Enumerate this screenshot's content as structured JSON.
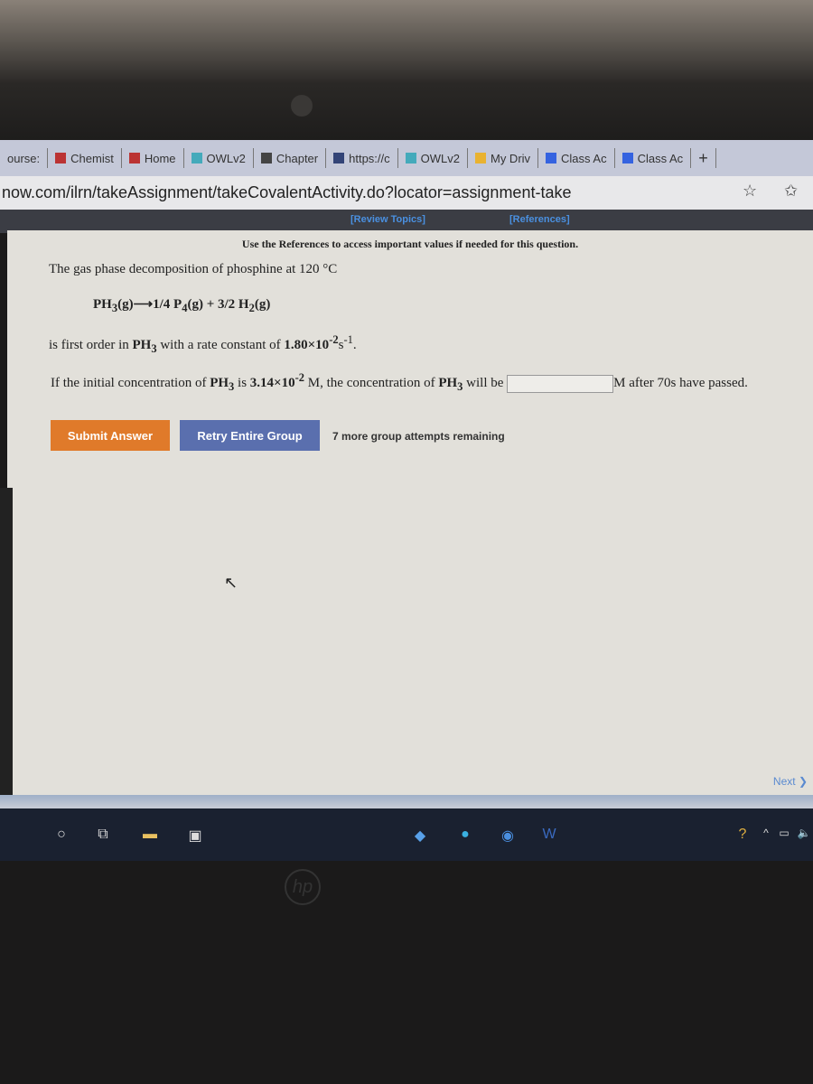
{
  "browser": {
    "tabs": [
      {
        "label": "ourse:",
        "icon": "page-icon"
      },
      {
        "label": "Chemist",
        "icon": "book-icon"
      },
      {
        "label": "Home",
        "icon": "book-icon"
      },
      {
        "label": "OWLv2",
        "icon": "owl-icon"
      },
      {
        "label": "Chapter",
        "icon": "chapter-icon"
      },
      {
        "label": "https://c",
        "icon": "image-icon"
      },
      {
        "label": "OWLv2",
        "icon": "owl-icon"
      },
      {
        "label": "My Driv",
        "icon": "drive-icon"
      },
      {
        "label": "Class Ac",
        "icon": "doc-icon"
      },
      {
        "label": "Class Ac",
        "icon": "doc-icon"
      }
    ],
    "new_tab": "+",
    "url": "now.com/ilrn/takeAssignment/takeCovalentActivity.do?locator=assignment-take"
  },
  "toolbar": {
    "review_topics": "[Review Topics]",
    "references": "[References]"
  },
  "question": {
    "ref_note": "Use the References to access important values if needed for this question.",
    "intro": "The gas phase decomposition of phosphine at 120 °C",
    "eq_lhs": "PH",
    "eq_lhs_sub": "3",
    "eq_lhs_end": "(g)",
    "eq_arrow": "⟶",
    "eq_p": "1/4 P",
    "eq_p_sub": "4",
    "eq_p_end": "(g) + 3/2 H",
    "eq_h_sub": "2",
    "eq_h_end": "(g)",
    "order_a": "is first order in ",
    "order_b": "PH",
    "order_sub": "3",
    "order_c": " with a rate constant of ",
    "k": "1.80×10",
    "k_exp": "-2",
    "k_unit": "s",
    "k_unit_exp": "-1",
    "init_a": "If the initial concentration of ",
    "init_b": "PH",
    "init_sub": "3",
    "init_c": " is ",
    "conc": "3.14×10",
    "conc_exp": "-2",
    "init_d": " M, the concentration of ",
    "init_e": "PH",
    "init_sub2": "3",
    "init_f": " will be ",
    "answer_value": "",
    "init_g": "M after 70s have passed."
  },
  "buttons": {
    "submit": "Submit Answer",
    "retry": "Retry Entire Group",
    "attempts": "7 more group attempts remaining",
    "next": "Next"
  },
  "colors": {
    "submit": "#e07a2a",
    "retry": "#5a6fae"
  },
  "brand": "hp"
}
